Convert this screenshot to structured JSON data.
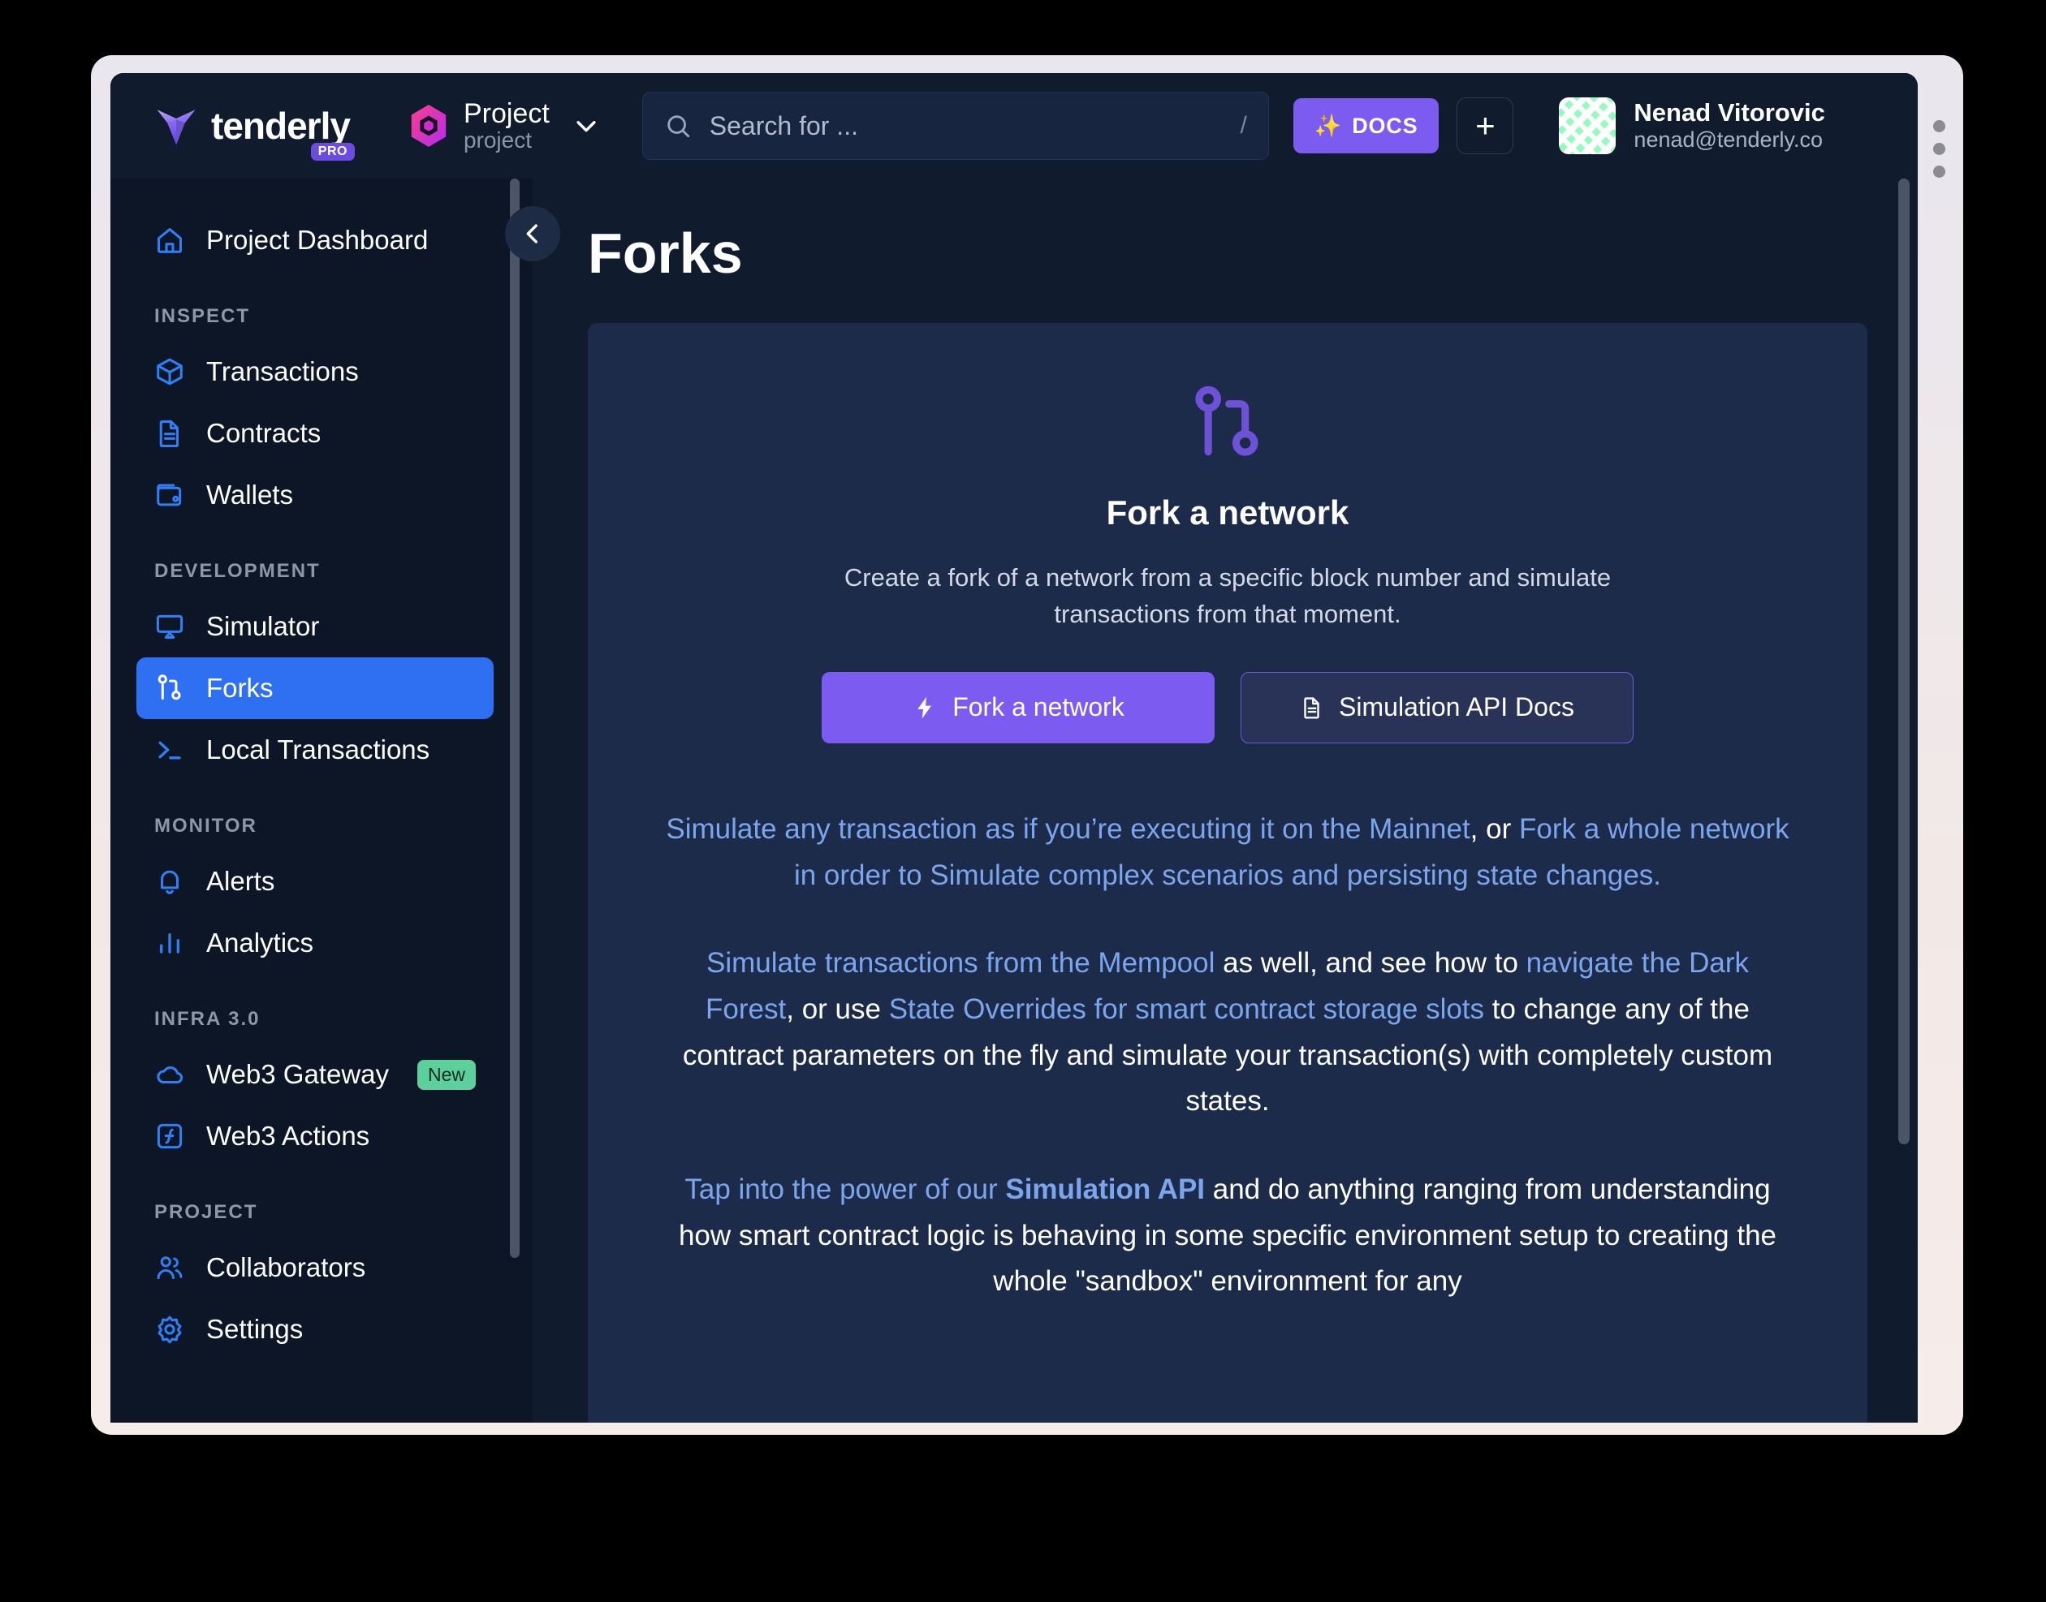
{
  "brand": {
    "name": "tenderly",
    "plan_badge": "PRO"
  },
  "project_selector": {
    "name": "Project",
    "slug": "project"
  },
  "search": {
    "placeholder": "Search for ...",
    "shortcut_hint": "/"
  },
  "topbar": {
    "docs_label": "DOCS",
    "docs_sparkle": "✨",
    "add_label": "+"
  },
  "user": {
    "name": "Nenad Vitorovic",
    "email": "nenad@tenderly.co"
  },
  "sidebar": {
    "dashboard": {
      "label": "Project Dashboard",
      "icon": "home-icon"
    },
    "sections": [
      {
        "title": "INSPECT",
        "items": [
          {
            "label": "Transactions",
            "icon": "cube-icon"
          },
          {
            "label": "Contracts",
            "icon": "document-icon"
          },
          {
            "label": "Wallets",
            "icon": "wallet-icon"
          }
        ]
      },
      {
        "title": "DEVELOPMENT",
        "items": [
          {
            "label": "Simulator",
            "icon": "simulator-icon"
          },
          {
            "label": "Forks",
            "icon": "fork-icon",
            "active": true
          },
          {
            "label": "Local Transactions",
            "icon": "terminal-icon"
          }
        ]
      },
      {
        "title": "MONITOR",
        "items": [
          {
            "label": "Alerts",
            "icon": "bell-icon"
          },
          {
            "label": "Analytics",
            "icon": "bar-chart-icon"
          }
        ]
      },
      {
        "title": "INFRA 3.0",
        "items": [
          {
            "label": "Web3 Gateway",
            "icon": "cloud-icon",
            "badge": "New"
          },
          {
            "label": "Web3 Actions",
            "icon": "function-icon"
          }
        ]
      },
      {
        "title": "PROJECT",
        "items": [
          {
            "label": "Collaborators",
            "icon": "users-icon"
          },
          {
            "label": "Settings",
            "icon": "gear-icon"
          }
        ]
      }
    ]
  },
  "page": {
    "title": "Forks"
  },
  "card": {
    "icon": "fork-icon",
    "title": "Fork a network",
    "subtitle": "Create a fork of a network from a specific block number and simulate transactions from that moment.",
    "primary_button": "Fork a network",
    "secondary_button": "Simulation API Docs"
  },
  "paragraphs": {
    "p1": {
      "a_link": "Simulate any transaction as if you’re executing it on the Mainnet",
      "b_plain": ", or ",
      "c_link": "Fork a whole network in order to Simulate complex scenarios and persisting state changes."
    },
    "p2": {
      "a_link": "Simulate transactions from the Mempool",
      "b_plain": " as well, and see how to ",
      "c_link": "navigate the Dark Forest",
      "d_plain": ", or use ",
      "e_link": "State Overrides for smart contract storage slots",
      "f_plain": " to change any of the contract parameters on the fly and simulate your transaction(s) with completely custom states."
    },
    "p3": {
      "a_link": "Tap into the power of our ",
      "b_bold_link": "Simulation API",
      "c_plain": " and do anything ranging from understanding how smart contract logic is behaving in some specific environment setup to creating the whole \"sandbox\" environment for any"
    }
  },
  "colors": {
    "accent_blue": "#2f6ff2",
    "accent_purple": "#7c5cf0",
    "link_blue": "#7ba6ee",
    "badge_green": "#5ccf9b",
    "card_bg": "#1d2b4a"
  }
}
